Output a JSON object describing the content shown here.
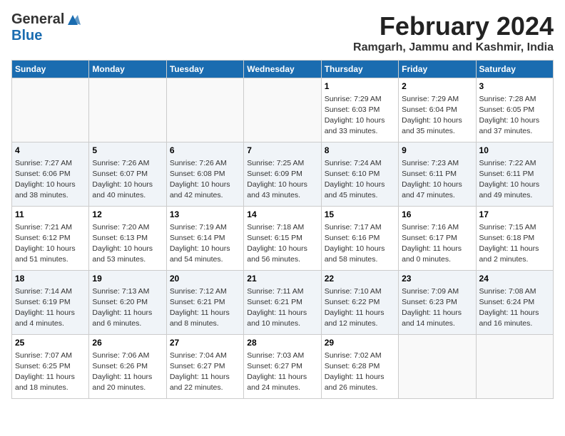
{
  "logo": {
    "general": "General",
    "blue": "Blue"
  },
  "title": "February 2024",
  "subtitle": "Ramgarh, Jammu and Kashmir, India",
  "days_of_week": [
    "Sunday",
    "Monday",
    "Tuesday",
    "Wednesday",
    "Thursday",
    "Friday",
    "Saturday"
  ],
  "weeks": [
    {
      "shade": false,
      "days": [
        {
          "num": "",
          "info": ""
        },
        {
          "num": "",
          "info": ""
        },
        {
          "num": "",
          "info": ""
        },
        {
          "num": "",
          "info": ""
        },
        {
          "num": "1",
          "info": "Sunrise: 7:29 AM\nSunset: 6:03 PM\nDaylight: 10 hours\nand 33 minutes."
        },
        {
          "num": "2",
          "info": "Sunrise: 7:29 AM\nSunset: 6:04 PM\nDaylight: 10 hours\nand 35 minutes."
        },
        {
          "num": "3",
          "info": "Sunrise: 7:28 AM\nSunset: 6:05 PM\nDaylight: 10 hours\nand 37 minutes."
        }
      ]
    },
    {
      "shade": true,
      "days": [
        {
          "num": "4",
          "info": "Sunrise: 7:27 AM\nSunset: 6:06 PM\nDaylight: 10 hours\nand 38 minutes."
        },
        {
          "num": "5",
          "info": "Sunrise: 7:26 AM\nSunset: 6:07 PM\nDaylight: 10 hours\nand 40 minutes."
        },
        {
          "num": "6",
          "info": "Sunrise: 7:26 AM\nSunset: 6:08 PM\nDaylight: 10 hours\nand 42 minutes."
        },
        {
          "num": "7",
          "info": "Sunrise: 7:25 AM\nSunset: 6:09 PM\nDaylight: 10 hours\nand 43 minutes."
        },
        {
          "num": "8",
          "info": "Sunrise: 7:24 AM\nSunset: 6:10 PM\nDaylight: 10 hours\nand 45 minutes."
        },
        {
          "num": "9",
          "info": "Sunrise: 7:23 AM\nSunset: 6:11 PM\nDaylight: 10 hours\nand 47 minutes."
        },
        {
          "num": "10",
          "info": "Sunrise: 7:22 AM\nSunset: 6:11 PM\nDaylight: 10 hours\nand 49 minutes."
        }
      ]
    },
    {
      "shade": false,
      "days": [
        {
          "num": "11",
          "info": "Sunrise: 7:21 AM\nSunset: 6:12 PM\nDaylight: 10 hours\nand 51 minutes."
        },
        {
          "num": "12",
          "info": "Sunrise: 7:20 AM\nSunset: 6:13 PM\nDaylight: 10 hours\nand 53 minutes."
        },
        {
          "num": "13",
          "info": "Sunrise: 7:19 AM\nSunset: 6:14 PM\nDaylight: 10 hours\nand 54 minutes."
        },
        {
          "num": "14",
          "info": "Sunrise: 7:18 AM\nSunset: 6:15 PM\nDaylight: 10 hours\nand 56 minutes."
        },
        {
          "num": "15",
          "info": "Sunrise: 7:17 AM\nSunset: 6:16 PM\nDaylight: 10 hours\nand 58 minutes."
        },
        {
          "num": "16",
          "info": "Sunrise: 7:16 AM\nSunset: 6:17 PM\nDaylight: 11 hours\nand 0 minutes."
        },
        {
          "num": "17",
          "info": "Sunrise: 7:15 AM\nSunset: 6:18 PM\nDaylight: 11 hours\nand 2 minutes."
        }
      ]
    },
    {
      "shade": true,
      "days": [
        {
          "num": "18",
          "info": "Sunrise: 7:14 AM\nSunset: 6:19 PM\nDaylight: 11 hours\nand 4 minutes."
        },
        {
          "num": "19",
          "info": "Sunrise: 7:13 AM\nSunset: 6:20 PM\nDaylight: 11 hours\nand 6 minutes."
        },
        {
          "num": "20",
          "info": "Sunrise: 7:12 AM\nSunset: 6:21 PM\nDaylight: 11 hours\nand 8 minutes."
        },
        {
          "num": "21",
          "info": "Sunrise: 7:11 AM\nSunset: 6:21 PM\nDaylight: 11 hours\nand 10 minutes."
        },
        {
          "num": "22",
          "info": "Sunrise: 7:10 AM\nSunset: 6:22 PM\nDaylight: 11 hours\nand 12 minutes."
        },
        {
          "num": "23",
          "info": "Sunrise: 7:09 AM\nSunset: 6:23 PM\nDaylight: 11 hours\nand 14 minutes."
        },
        {
          "num": "24",
          "info": "Sunrise: 7:08 AM\nSunset: 6:24 PM\nDaylight: 11 hours\nand 16 minutes."
        }
      ]
    },
    {
      "shade": false,
      "days": [
        {
          "num": "25",
          "info": "Sunrise: 7:07 AM\nSunset: 6:25 PM\nDaylight: 11 hours\nand 18 minutes."
        },
        {
          "num": "26",
          "info": "Sunrise: 7:06 AM\nSunset: 6:26 PM\nDaylight: 11 hours\nand 20 minutes."
        },
        {
          "num": "27",
          "info": "Sunrise: 7:04 AM\nSunset: 6:27 PM\nDaylight: 11 hours\nand 22 minutes."
        },
        {
          "num": "28",
          "info": "Sunrise: 7:03 AM\nSunset: 6:27 PM\nDaylight: 11 hours\nand 24 minutes."
        },
        {
          "num": "29",
          "info": "Sunrise: 7:02 AM\nSunset: 6:28 PM\nDaylight: 11 hours\nand 26 minutes."
        },
        {
          "num": "",
          "info": ""
        },
        {
          "num": "",
          "info": ""
        }
      ]
    }
  ]
}
